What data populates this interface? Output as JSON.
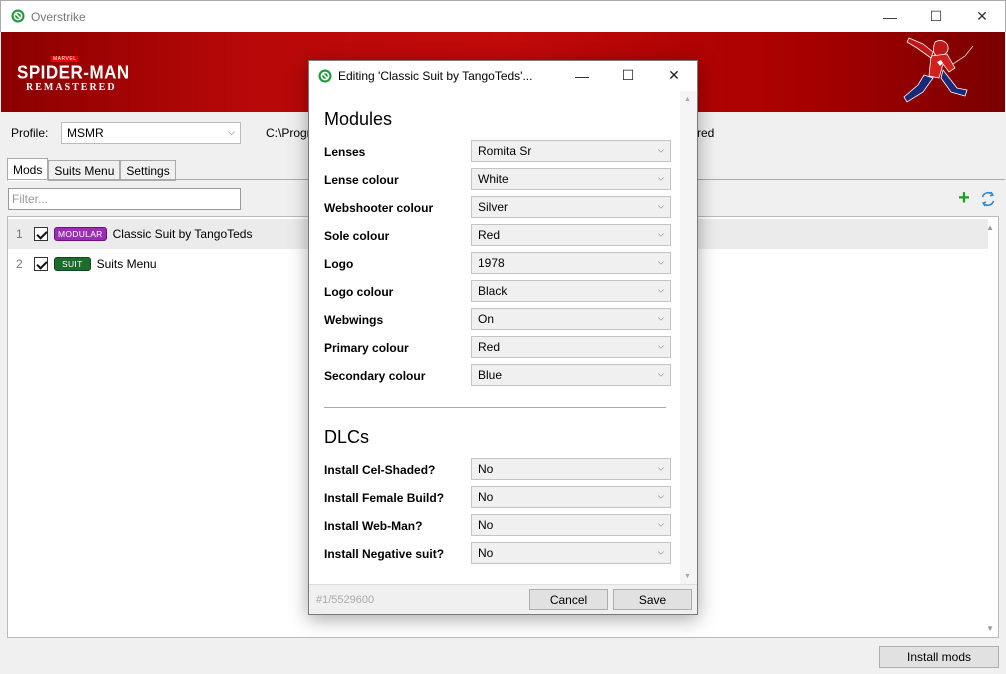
{
  "app": {
    "title": "Overstrike",
    "controls": {
      "minimize": "—",
      "maximize": "☐",
      "close": "✕"
    }
  },
  "banner": {
    "logo_marvel": "MARVEL",
    "logo_main": "SPIDER-MAN",
    "logo_sub": "REMASTERED",
    "colors": {
      "banner_red": "#b80808"
    }
  },
  "profile": {
    "label": "Profile:",
    "value": "MSMR",
    "path_partial": "C:\\Progr",
    "path_right_partial": "red"
  },
  "tabs": [
    {
      "label": "Mods",
      "active": true
    },
    {
      "label": "Suits Menu",
      "active": false
    },
    {
      "label": "Settings",
      "active": false
    }
  ],
  "filter": {
    "placeholder": "Filter..."
  },
  "mods": [
    {
      "num": "1",
      "checked": true,
      "badge": "MODULAR",
      "name": "Classic Suit by TangoTeds"
    },
    {
      "num": "2",
      "checked": true,
      "badge": "SUIT",
      "name": "Suits Menu"
    }
  ],
  "install_button": "Install mods",
  "dialog": {
    "title": "Editing 'Classic Suit by TangoTeds'...",
    "controls": {
      "minimize": "—",
      "maximize": "☐",
      "close": "✕"
    },
    "modules_title": "Modules",
    "modules": [
      {
        "label": "Lenses",
        "value": "Romita Sr"
      },
      {
        "label": "Lense colour",
        "value": "White"
      },
      {
        "label": "Webshooter colour",
        "value": "Silver"
      },
      {
        "label": "Sole colour",
        "value": "Red"
      },
      {
        "label": "Logo",
        "value": "1978"
      },
      {
        "label": "Logo colour",
        "value": "Black"
      },
      {
        "label": "Webwings",
        "value": "On"
      },
      {
        "label": "Primary colour",
        "value": "Red"
      },
      {
        "label": "Secondary colour",
        "value": "Blue"
      }
    ],
    "dlcs_title": "DLCs",
    "dlcs": [
      {
        "label": "Install Cel-Shaded?",
        "value": "No"
      },
      {
        "label": "Install Female Build?",
        "value": "No"
      },
      {
        "label": "Install Web-Man?",
        "value": "No"
      },
      {
        "label": "Install Negative suit?",
        "value": "No"
      }
    ],
    "footer_id": "#1/5529600",
    "cancel_label": "Cancel",
    "save_label": "Save"
  }
}
